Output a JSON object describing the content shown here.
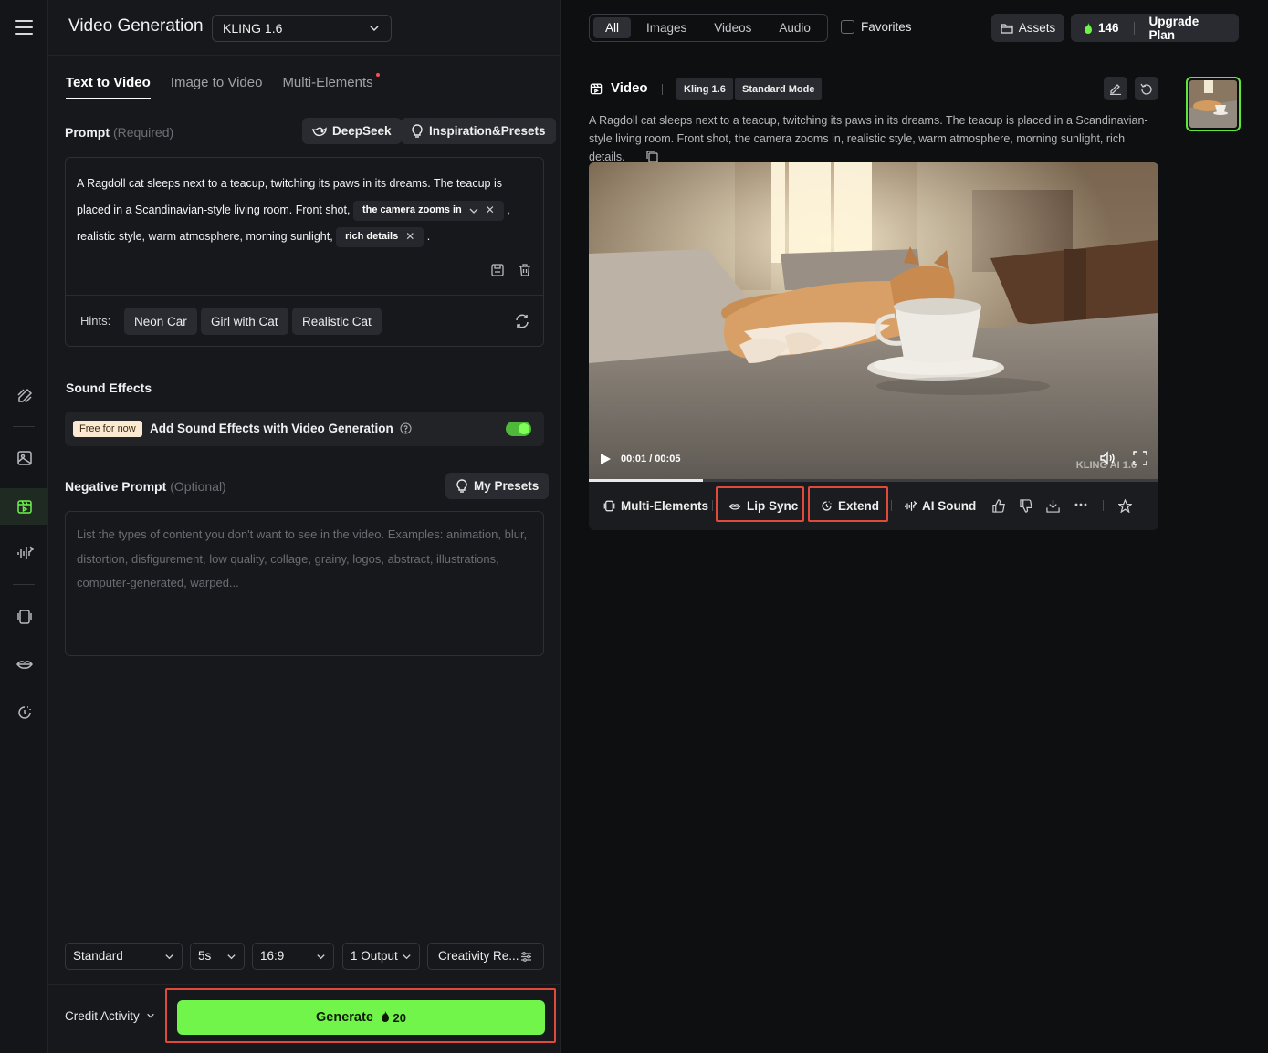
{
  "header": {
    "app_title": "Video Generation",
    "model": "KLING 1.6"
  },
  "tabs": [
    {
      "label": "Text to Video",
      "active": true
    },
    {
      "label": "Image to Video",
      "active": false
    },
    {
      "label": "Multi-Elements",
      "active": false
    }
  ],
  "prompt": {
    "label": "Prompt",
    "required_note": "(Required)",
    "deepseek_label": "DeepSeek",
    "inspiration_label": "Inspiration&Presets",
    "text_part1": "A Ragdoll cat sleeps next to a teacup, twitching its paws in its dreams. The teacup is placed in a Scandinavian-style living room. Front shot, ",
    "chip1": "the camera zooms in",
    "text_part2": " , realistic style, warm atmosphere, morning sunlight, ",
    "chip2": "rich details",
    "text_part3": " .",
    "hints_label": "Hints:",
    "hints": [
      "Neon Car",
      "Girl with Cat",
      "Realistic Cat"
    ]
  },
  "sound": {
    "label": "Sound Effects",
    "badge": "Free for now",
    "text": "Add Sound Effects with Video Generation",
    "enabled": true
  },
  "negative": {
    "label": "Negative Prompt",
    "optional_note": "(Optional)",
    "presets_label": "My Presets",
    "placeholder": "List the types of content you don't want to see in the video. Examples: animation, blur, distortion, disfigurement, low quality, collage, grainy, logos, abstract, illustrations, computer-generated, warped..."
  },
  "options": {
    "mode": "Standard",
    "duration": "5s",
    "ratio": "16:9",
    "outputs": "1 Output",
    "creativity": "Creativity Re..."
  },
  "footer": {
    "credit_activity": "Credit Activity",
    "generate_label": "Generate",
    "generate_cost": "20"
  },
  "right_header": {
    "filters": [
      {
        "label": "All",
        "active": true
      },
      {
        "label": "Images",
        "active": false
      },
      {
        "label": "Videos",
        "active": false
      },
      {
        "label": "Audio",
        "active": false
      }
    ],
    "favorites": "Favorites",
    "assets": "Assets",
    "credits": "146",
    "upgrade": "Upgrade Plan"
  },
  "video_card": {
    "title": "Video",
    "model_tag": "Kling 1.6",
    "mode_tag": "Standard Mode",
    "description": "A Ragdoll cat sleeps next to a teacup, twitching its paws in its dreams. The teacup is placed in a Scandinavian-style living room. Front shot, the camera zooms in, realistic style, warm atmosphere, morning sunlight, rich details.",
    "time": "00:01 / 00:05",
    "progress": 0.2,
    "watermark": "KLING AI 1.6",
    "actions": {
      "multi_elements": "Multi-Elements",
      "lip_sync": "Lip Sync",
      "extend": "Extend",
      "ai_sound": "AI Sound"
    }
  },
  "colors": {
    "accent": "#72f54b",
    "highlight": "#e04a3c"
  }
}
